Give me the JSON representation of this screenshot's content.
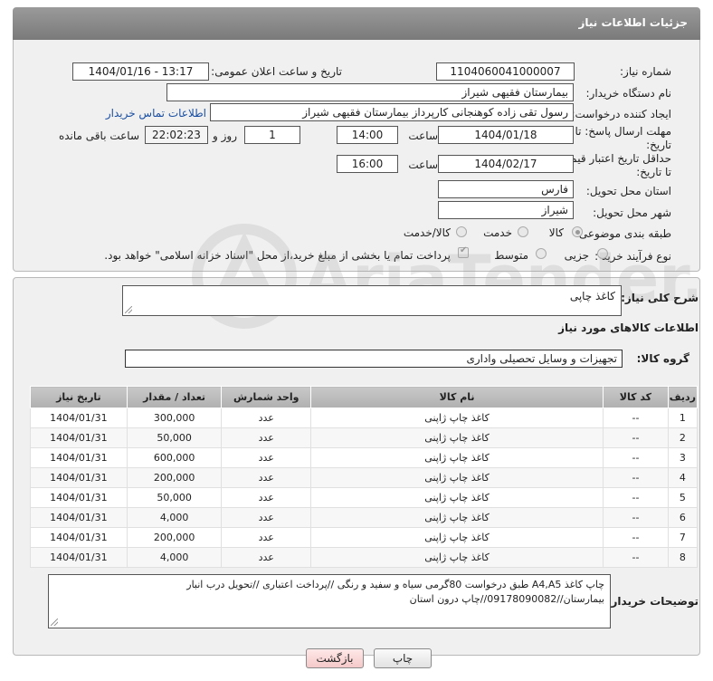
{
  "header": {
    "title": "جزئیات اطلاعات نیاز"
  },
  "form": {
    "need_number_label": "شماره نیاز:",
    "need_number": "1104060041000007",
    "announce_label": "تاریخ و ساعت اعلان عمومی:",
    "announce_value": "1404/01/16 - 13:17",
    "buyer_org_label": "نام دستگاه خریدار:",
    "buyer_org": "بیمارستان فقیهی شیراز",
    "creator_label": "ایجاد کننده درخواست:",
    "creator": "رسول تقی زاده کوهنجانی کارپرداز بیمارستان فقیهی شیراز",
    "contact_link": "اطلاعات تماس خریدار",
    "deadline_label_1": "مهلت ارسال پاسخ: تا",
    "deadline_label_2": "تاریخ:",
    "deadline_date": "1404/01/18",
    "time_label": "ساعت",
    "deadline_time": "14:00",
    "days_value": "1",
    "days_label": "روز و",
    "remaining_time": "22:02:23",
    "remaining_label": "ساعت باقی مانده",
    "price_valid_label_1": "حداقل تاریخ اعتبار قیمت:",
    "price_valid_label_2": "تا تاریخ:",
    "price_valid_date": "1404/02/17",
    "price_valid_time": "16:00",
    "province_label": "استان محل تحویل:",
    "province": "فارس",
    "city_label": "شهر محل تحویل:",
    "city": "شیراز",
    "category_label": "طبقه بندی موضوعی:",
    "category_options": [
      "کالا",
      "خدمت",
      "کالا/خدمت"
    ],
    "process_label": "نوع فرآیند خرید :",
    "process_options": [
      "جزیی",
      "متوسط"
    ],
    "payment_note": "پرداخت تمام یا بخشی از مبلغ خرید،از محل \"اسناد خزانه اسلامی\" خواهد بود."
  },
  "summary": {
    "desc_label": "شرح کلی نیاز:",
    "desc_value": "کاغذ چاپی",
    "goods_info_title": "اطلاعات کالاهای مورد نیاز",
    "group_label": "گروه کالا:",
    "group_value": "تجهیزات و وسایل تحصیلی واداری"
  },
  "table": {
    "headers": [
      "ردیف",
      "کد کالا",
      "نام کالا",
      "واحد شمارش",
      "تعداد / مقدار",
      "تاریخ نیاز"
    ],
    "rows": [
      [
        "1",
        "--",
        "کاغذ چاپ ژاپنی",
        "عدد",
        "300,000",
        "1404/01/31"
      ],
      [
        "2",
        "--",
        "کاغذ چاپ ژاپنی",
        "عدد",
        "50,000",
        "1404/01/31"
      ],
      [
        "3",
        "--",
        "کاغذ چاپ ژاپنی",
        "عدد",
        "600,000",
        "1404/01/31"
      ],
      [
        "4",
        "--",
        "کاغذ چاپ ژاپنی",
        "عدد",
        "200,000",
        "1404/01/31"
      ],
      [
        "5",
        "--",
        "کاغذ چاپ ژاپنی",
        "عدد",
        "50,000",
        "1404/01/31"
      ],
      [
        "6",
        "--",
        "کاغذ چاپ ژاپنی",
        "عدد",
        "4,000",
        "1404/01/31"
      ],
      [
        "7",
        "--",
        "کاغذ چاپ ژاپنی",
        "عدد",
        "200,000",
        "1404/01/31"
      ],
      [
        "8",
        "--",
        "کاغذ چاپ ژاپنی",
        "عدد",
        "4,000",
        "1404/01/31"
      ]
    ]
  },
  "notes": {
    "label": "توضیحات خریدار:",
    "line1": "چاپ کاغذ A4,A5 طبق درخواست 80گرمی سیاه و سفید و رنگی //پرداخت اعتباری //تحویل درب انبار",
    "line2": "بیمارستان//09178090082//چاپ درون استان"
  },
  "buttons": {
    "print": "چاپ",
    "back": "بازگشت"
  },
  "watermark": {
    "text": "AriaTender.net"
  }
}
